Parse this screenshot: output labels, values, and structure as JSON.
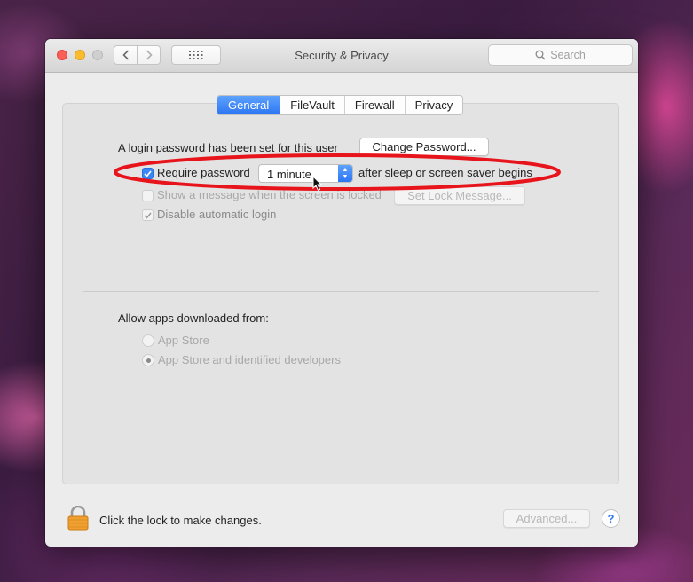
{
  "window": {
    "title": "Security & Privacy",
    "search_placeholder": "Search"
  },
  "tabs": [
    {
      "label": "General",
      "active": true
    },
    {
      "label": "FileVault",
      "active": false
    },
    {
      "label": "Firewall",
      "active": false
    },
    {
      "label": "Privacy",
      "active": false
    }
  ],
  "general": {
    "login_password_text": "A login password has been set for this user",
    "change_password_label": "Change Password...",
    "require_password": {
      "label": "Require password",
      "checked": true
    },
    "require_delay_value": "1 minute",
    "after_sleep_text": "after sleep or screen saver begins",
    "show_message": {
      "label": "Show a message when the screen is locked",
      "checked": false
    },
    "set_lock_message_label": "Set Lock Message...",
    "disable_auto_login": {
      "label": "Disable automatic login",
      "checked": true
    }
  },
  "downloads": {
    "heading": "Allow apps downloaded from:",
    "options": [
      {
        "label": "App Store",
        "selected": false
      },
      {
        "label": "App Store and identified developers",
        "selected": true
      }
    ]
  },
  "footer": {
    "lock_text": "Click the lock to make changes.",
    "advanced_label": "Advanced...",
    "help_label": "?"
  },
  "colors": {
    "accent": "#2d76f4",
    "annotation": "#e8141c"
  }
}
